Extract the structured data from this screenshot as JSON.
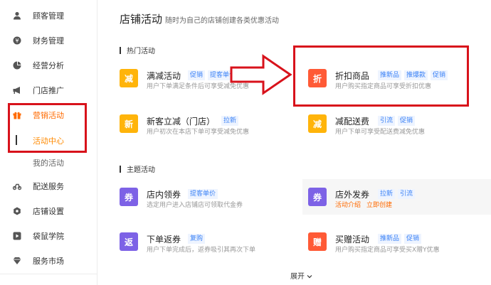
{
  "sidebar": {
    "items": [
      {
        "label": "顾客管理",
        "icon": "user-icon"
      },
      {
        "label": "财务管理",
        "icon": "money-icon"
      },
      {
        "label": "经营分析",
        "icon": "pie-chart-icon"
      },
      {
        "label": "门店推广",
        "icon": "megaphone-icon"
      },
      {
        "label": "营销活动",
        "icon": "gift-icon"
      },
      {
        "label": "配送服务",
        "icon": "bike-icon"
      },
      {
        "label": "店铺设置",
        "icon": "settings-icon"
      },
      {
        "label": "袋鼠学院",
        "icon": "play-icon"
      },
      {
        "label": "服务市场",
        "icon": "diamond-icon"
      }
    ],
    "sub_items": [
      {
        "label": "活动中心"
      },
      {
        "label": "我的活动"
      }
    ]
  },
  "header": {
    "title": "店铺活动",
    "subtitle": "随时为自己的店铺创建各类优惠活动"
  },
  "sections": {
    "hot": "热门活动",
    "theme": "主题活动"
  },
  "cards": {
    "mianjian": {
      "badge": "减",
      "name": "满减活动",
      "tags": [
        "促销",
        "提客单价"
      ],
      "desc": "用户下单满足条件后可享受减免优惠"
    },
    "zhekou": {
      "badge": "折",
      "name": "折扣商品",
      "tags": [
        "推新品",
        "推爆款",
        "促销"
      ],
      "desc": "用户购买指定商品可享受折扣优惠"
    },
    "xinke": {
      "badge": "新",
      "name": "新客立减（门店）",
      "tags": [
        "拉新"
      ],
      "desc": "用户初次在本店下单可享受减免优惠"
    },
    "peisong": {
      "badge": "减",
      "name": "减配送费",
      "tags": [
        "引流",
        "促销"
      ],
      "desc": "用户下单可享受配送费减免优惠"
    },
    "lingquan": {
      "badge": "券",
      "name": "店内领券",
      "tags": [
        "提客单价"
      ],
      "desc": "选定用户进入店铺店可领取代金券"
    },
    "faquan": {
      "badge": "券",
      "name": "店外发券",
      "tags": [
        "拉新",
        "引流"
      ],
      "links": [
        "活动介绍",
        "立即创建"
      ]
    },
    "fanquan": {
      "badge": "返",
      "name": "下单返券",
      "tags": [
        "复购"
      ],
      "desc": "用户下单完成后，返券吸引其再次下单"
    },
    "maizeng": {
      "badge": "赠",
      "name": "买赠活动",
      "tags": [
        "推新品",
        "促销"
      ],
      "desc": "用户购买指定商品可享受买X赠Y优惠"
    }
  },
  "expand_label": "展开",
  "colors": {
    "accent": "#ff6a00",
    "tag_text": "#3b82f6",
    "badge_yellow": "#ffb40a",
    "badge_red": "#ff5a36",
    "badge_purple": "#7d62e6",
    "annotation_red": "#d8121b"
  }
}
